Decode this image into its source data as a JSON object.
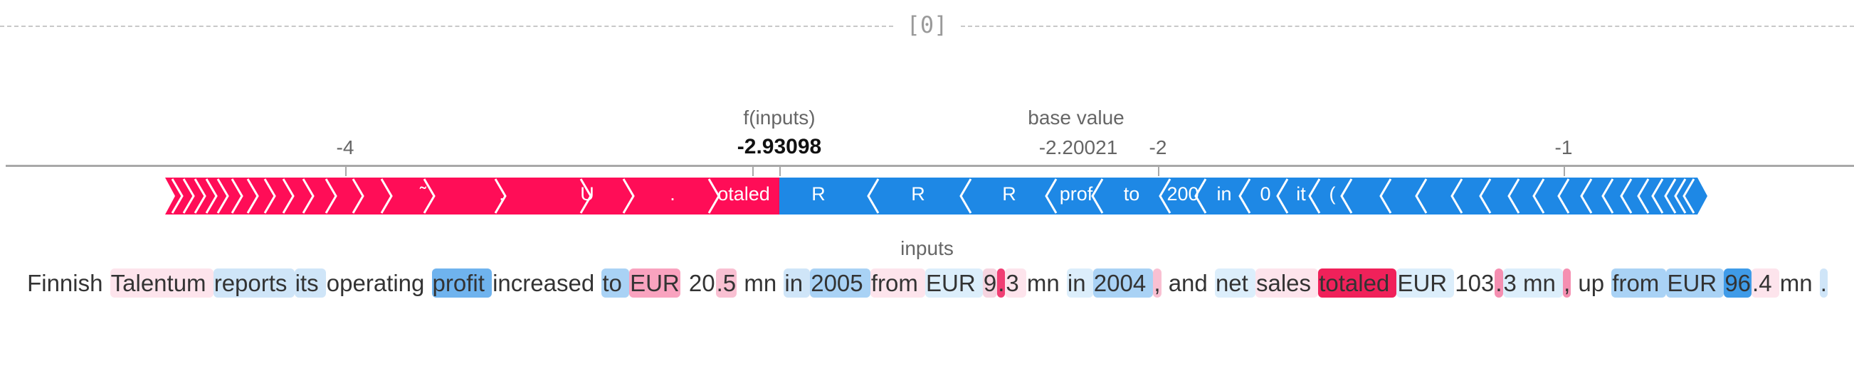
{
  "header": {
    "label": "[0]"
  },
  "axis": {
    "ticks": [
      "-4",
      "-2",
      "-1"
    ],
    "output_title": "f(inputs)",
    "output_value": "-2.93098",
    "base_title": "base value",
    "base_value": "-2.20021"
  },
  "chart_data": {
    "type": "bar",
    "x_range": [
      -5.0,
      -0.5
    ],
    "output_value": -2.93098,
    "base_value": -2.20021,
    "colors": {
      "positive": "#ff0d57",
      "negative": "#1e88e5"
    },
    "segment_labels": [
      "̃",
      ".",
      "U",
      ".",
      "otaled",
      "R",
      "R",
      "R",
      "prof",
      "to",
      "200",
      "in",
      "0",
      "it",
      "("
    ]
  },
  "force_segments": {
    "positive": [
      {
        "label": "̃"
      },
      {
        "label": "."
      },
      {
        "label": "U"
      },
      {
        "label": "."
      },
      {
        "label": "otaled"
      }
    ],
    "negative": [
      {
        "label": "R"
      },
      {
        "label": "R"
      },
      {
        "label": "R"
      },
      {
        "label": "prof"
      },
      {
        "label": "to"
      },
      {
        "label": "200"
      },
      {
        "label": "in"
      },
      {
        "label": "0"
      },
      {
        "label": "it"
      },
      {
        "label": "("
      }
    ]
  },
  "inputs": {
    "title": "inputs",
    "tokens": [
      {
        "text": "Finnish ",
        "color": "#ffffff"
      },
      {
        "text": "Talentum ",
        "color": "#fde4ec"
      },
      {
        "text": "reports ",
        "color": "#cfe5f8"
      },
      {
        "text": "its ",
        "color": "#cfe5f8"
      },
      {
        "text": "operating ",
        "color": "#ffffff"
      },
      {
        "text": "profit ",
        "color": "#6fb3ee"
      },
      {
        "text": "increased ",
        "color": "#ffffff"
      },
      {
        "text": "to ",
        "color": "#a9d2f5"
      },
      {
        "text": "EUR",
        "color": "#f9a3bf"
      },
      {
        "text": " ",
        "color": "#ffffff"
      },
      {
        "text": "20",
        "color": "#ffffff"
      },
      {
        "text": ".5",
        "color": "#f9c0d2"
      },
      {
        "text": " mn ",
        "color": "#ffffff"
      },
      {
        "text": "in ",
        "color": "#cfe5f8"
      },
      {
        "text": "2005 ",
        "color": "#a9d2f5"
      },
      {
        "text": "from ",
        "color": "#fde4ec"
      },
      {
        "text": "EUR ",
        "color": "#dceefb"
      },
      {
        "text": "9",
        "color": "#f6d4e0"
      },
      {
        "text": ".",
        "color": "#f03f74"
      },
      {
        "text": "3 ",
        "color": "#fde4ec"
      },
      {
        "text": "mn ",
        "color": "#ffffff"
      },
      {
        "text": "in ",
        "color": "#dceefb"
      },
      {
        "text": "2004 ",
        "color": "#a9d2f5"
      },
      {
        "text": ",",
        "color": "#f9c0d2"
      },
      {
        "text": " and ",
        "color": "#ffffff"
      },
      {
        "text": "net ",
        "color": "#dceefb"
      },
      {
        "text": "sales ",
        "color": "#fde4ec"
      },
      {
        "text": "totaled ",
        "color": "#f0215a"
      },
      {
        "text": "EUR ",
        "color": "#dceefb"
      },
      {
        "text": "103",
        "color": "#ffffff"
      },
      {
        "text": ".",
        "color": "#f58fb1"
      },
      {
        "text": "3 mn ",
        "color": "#dceefb"
      },
      {
        "text": ",",
        "color": "#f58fb1"
      },
      {
        "text": " up ",
        "color": "#ffffff"
      },
      {
        "text": "from ",
        "color": "#a9d2f5"
      },
      {
        "text": "EUR ",
        "color": "#a9d2f5"
      },
      {
        "text": "96",
        "color": "#3f9be8"
      },
      {
        "text": ".4 ",
        "color": "#fde4ec"
      },
      {
        "text": "mn ",
        "color": "#ffffff"
      },
      {
        "text": ".",
        "color": "#cfe5f8"
      }
    ]
  }
}
